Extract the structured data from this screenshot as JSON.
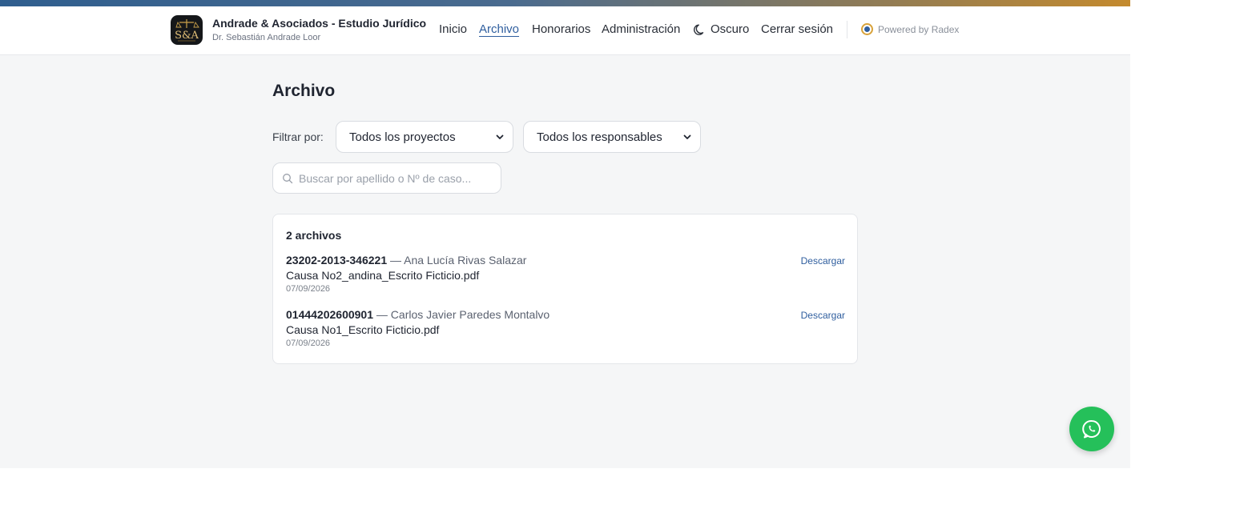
{
  "header": {
    "brand_title": "Andrade & Asociados - Estudio Jurídico",
    "brand_subtitle": "Dr. Sebastián Andrade Loor",
    "logo_text": "S&A",
    "nav": {
      "inicio": "Inicio",
      "archivo": "Archivo",
      "honorarios": "Honorarios",
      "administracion": "Administración",
      "oscuro": "Oscuro",
      "cerrar_sesion": "Cerrar sesión"
    },
    "active_nav": "Archivo",
    "powered_by": "Powered by Radex"
  },
  "main": {
    "title": "Archivo",
    "filter_label": "Filtrar por:",
    "project_select": "Todos los proyectos",
    "responsible_select": "Todos los responsables",
    "search_placeholder": "Buscar por apellido o Nº de caso...",
    "card": {
      "count": "2 archivos",
      "download_label": "Descargar",
      "files": [
        {
          "case_number": "23202-2013-346221",
          "client": "— Ana Lucía Rivas Salazar",
          "filename": "Causa No2_andina_Escrito Ficticio.pdf",
          "date": "07/09/2026"
        },
        {
          "case_number": "01444202600901",
          "client": "— Carlos Javier Paredes Montalvo",
          "filename": "Causa No1_Escrito Ficticio.pdf",
          "date": "07/09/2026"
        }
      ]
    }
  },
  "colors": {
    "accent": "#2f5e9e",
    "whatsapp": "#25c05a",
    "gold": "#d8a23a"
  },
  "icons": {
    "logo": "scales-of-justice-logo",
    "moon": "moon-icon",
    "search": "search-icon",
    "chevron": "chevron-down-icon",
    "whatsapp": "whatsapp-icon"
  }
}
